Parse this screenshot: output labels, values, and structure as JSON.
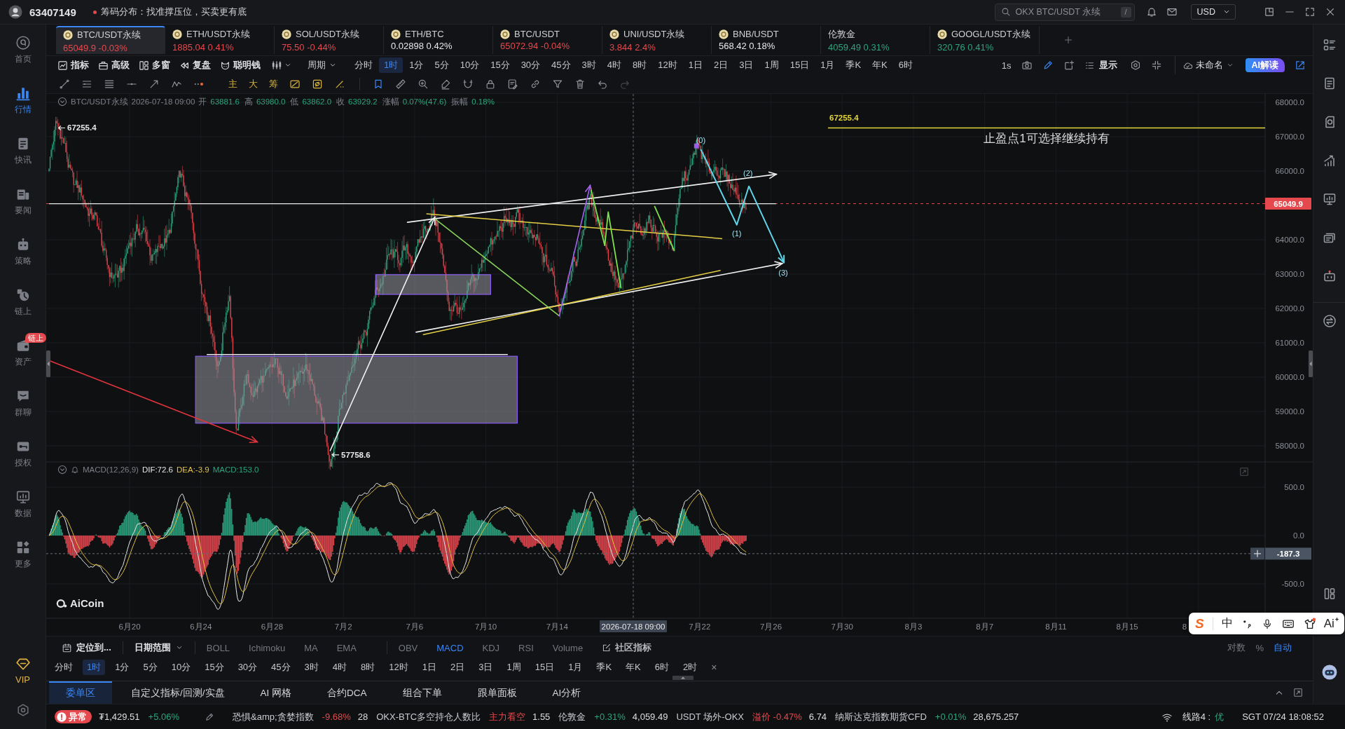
{
  "top_bar": {
    "user_id": "63407149",
    "notice": "筹码分布：找准撑压位，买卖更有底",
    "search": {
      "placeholder": "OKX BTC/USDT 永续",
      "shortcut": "/"
    },
    "currency": "USD"
  },
  "sidebar": {
    "items": [
      {
        "label": "首页",
        "selected": false
      },
      {
        "label": "行情",
        "selected": true
      },
      {
        "label": "快讯",
        "selected": false
      },
      {
        "label": "要闻",
        "selected": false
      },
      {
        "label": "策略",
        "selected": false
      },
      {
        "label": "链上",
        "selected": false
      },
      {
        "label": "资产",
        "selected": false,
        "badge": "链上"
      },
      {
        "label": "群聊",
        "selected": false
      },
      {
        "label": "授权",
        "selected": false
      },
      {
        "label": "数据",
        "selected": false
      },
      {
        "label": "更多",
        "selected": false
      }
    ],
    "vip": "VIP"
  },
  "tabs": [
    {
      "kind": "coin",
      "symbol": "BTC/USDT永续",
      "price": "65049.9",
      "change": "-0.03%",
      "color": "#e5484d",
      "selected": true
    },
    {
      "kind": "coin",
      "symbol": "ETH/USDT永续",
      "price": "1885.04",
      "change": "0.41%",
      "color": "#e5484d",
      "selected": false
    },
    {
      "kind": "coin",
      "symbol": "SOL/USDT永续",
      "price": "75.50",
      "change": "-0.44%",
      "color": "#e5484d",
      "selected": false
    },
    {
      "kind": "coin",
      "symbol": "ETH/BTC",
      "price": "0.02898",
      "change": "0.42%",
      "color": "#e8e8ea",
      "selected": false
    },
    {
      "kind": "coin",
      "symbol": "BTC/USDT",
      "price": "65072.94",
      "change": "-0.04%",
      "color": "#e5484d",
      "selected": false
    },
    {
      "kind": "coin",
      "symbol": "UNI/USDT永续",
      "price": "3.844",
      "change": "2.4%",
      "color": "#e5484d",
      "selected": false
    },
    {
      "kind": "coin",
      "symbol": "BNB/USDT",
      "price": "568.42",
      "change": "0.18%",
      "color": "#e8e8ea",
      "selected": false
    },
    {
      "kind": "plain",
      "symbol": "伦敦金",
      "price": "4059.49",
      "change": "0.31%",
      "color": "#2ea37c",
      "selected": false
    },
    {
      "kind": "coin",
      "symbol": "GOOGL/USDT永续",
      "price": "320.76",
      "change": "0.41%",
      "color": "#2ea37c",
      "selected": false
    }
  ],
  "toolbar": {
    "tools": [
      "指标",
      "高级",
      "多窗",
      "复盘",
      "聪明钱"
    ],
    "period_menu": "周期",
    "periods": [
      {
        "label": "分时",
        "selected": false
      },
      {
        "label": "1时",
        "selected": true
      },
      {
        "label": "1分",
        "selected": false
      },
      {
        "label": "5分",
        "selected": false
      },
      {
        "label": "10分",
        "selected": false
      },
      {
        "label": "15分",
        "selected": false
      },
      {
        "label": "30分",
        "selected": false
      },
      {
        "label": "45分",
        "selected": false
      },
      {
        "label": "3时",
        "selected": false
      },
      {
        "label": "4时",
        "selected": false
      },
      {
        "label": "8时",
        "selected": false
      },
      {
        "label": "12时",
        "selected": false
      },
      {
        "label": "1日",
        "selected": false
      },
      {
        "label": "2日",
        "selected": false
      },
      {
        "label": "3日",
        "selected": false
      },
      {
        "label": "1周",
        "selected": false
      },
      {
        "label": "15日",
        "selected": false
      },
      {
        "label": "1月",
        "selected": false
      },
      {
        "label": "季K",
        "selected": false
      },
      {
        "label": "年K",
        "selected": false
      },
      {
        "label": "6时",
        "selected": false
      }
    ],
    "interval": "1s",
    "draw_mode": true,
    "display": "显示",
    "layout_name": "未命名",
    "ai_button": "AI解读"
  },
  "drawing_bar": {
    "marks": [
      "主",
      "大",
      "筹"
    ],
    "keep_drawing": true,
    "redo_disabled": true
  },
  "chart": {
    "legend": {
      "symbol": "BTC/USDT永续",
      "time": "2026-07-18 09:00",
      "fields": [
        {
          "label": "开",
          "value": "63881.6"
        },
        {
          "label": "高",
          "value": "63980.0"
        },
        {
          "label": "低",
          "value": "63862.0"
        },
        {
          "label": "收",
          "value": "63929.2"
        },
        {
          "label": "涨幅",
          "value": "0.07%(47.6)"
        },
        {
          "label": "振幅",
          "value": "0.18%"
        }
      ]
    },
    "price_axis": [
      "68000.0",
      "67000.0",
      "66000.0",
      "64000.0",
      "63000.0",
      "62000.0",
      "61000.0",
      "60000.0",
      "59000.0",
      "58000.0"
    ],
    "price_tag": "65049.9",
    "high_mark": "67255.4",
    "low_mark": "57758.6",
    "target_label": "67255.4",
    "note": "止盈点1可选择继续持有",
    "wave_labels": [
      "(0)",
      "(1)",
      "(2)",
      "(3)"
    ],
    "date_axis": [
      "6月20",
      "6月24",
      "6月28",
      "7月2",
      "7月6",
      "7月10",
      "7月14",
      "7月22",
      "7月26",
      "7月30",
      "8月3",
      "8月7",
      "8月11",
      "8月15",
      "8"
    ],
    "crosshair_time": "2026-07-18 09:00",
    "logo": "AiCoin"
  },
  "macd": {
    "name": "MACD(12,26,9)",
    "dif": "DIF:72.6",
    "dea": "DEA:-3.9",
    "macd": "MACD:153.0",
    "axis": [
      "500.0",
      "0.0",
      "-500.0"
    ],
    "cursor_value": "-187.3"
  },
  "indicator_bar": {
    "locate": "定位到...",
    "date_range": "日期范围",
    "overlays": [
      {
        "label": "BOLL",
        "selected": false
      },
      {
        "label": "Ichimoku",
        "selected": false
      },
      {
        "label": "MA",
        "selected": false
      },
      {
        "label": "EMA",
        "selected": false
      }
    ],
    "panes": [
      {
        "label": "OBV",
        "selected": false
      },
      {
        "label": "MACD",
        "selected": true
      },
      {
        "label": "KDJ",
        "selected": false
      },
      {
        "label": "RSI",
        "selected": false
      },
      {
        "label": "Volume",
        "selected": false
      }
    ],
    "community": "社区指标",
    "scale_modes": [
      {
        "label": "对数",
        "selected": false
      },
      {
        "label": "%",
        "selected": false
      },
      {
        "label": "自动",
        "selected": true
      }
    ]
  },
  "period_bar": {
    "periods": [
      {
        "label": "分时",
        "selected": false
      },
      {
        "label": "1时",
        "selected": true
      },
      {
        "label": "1分",
        "selected": false
      },
      {
        "label": "5分",
        "selected": false
      },
      {
        "label": "10分",
        "selected": false
      },
      {
        "label": "15分",
        "selected": false
      },
      {
        "label": "30分",
        "selected": false
      },
      {
        "label": "45分",
        "selected": false
      },
      {
        "label": "3时",
        "selected": false
      },
      {
        "label": "4时",
        "selected": false
      },
      {
        "label": "8时",
        "selected": false
      },
      {
        "label": "12时",
        "selected": false
      },
      {
        "label": "1日",
        "selected": false
      },
      {
        "label": "2日",
        "selected": false
      },
      {
        "label": "3日",
        "selected": false
      },
      {
        "label": "1周",
        "selected": false
      },
      {
        "label": "15日",
        "selected": false
      },
      {
        "label": "1月",
        "selected": false
      },
      {
        "label": "季K",
        "selected": false
      },
      {
        "label": "年K",
        "selected": false
      },
      {
        "label": "6时",
        "selected": false
      },
      {
        "label": "2时",
        "selected": false
      }
    ],
    "close": "×"
  },
  "bottom_tabs": [
    {
      "label": "委单区",
      "selected": true
    },
    {
      "label": "自定义指标/回测/实盘",
      "selected": false
    },
    {
      "label": "AI 网格",
      "selected": false
    },
    {
      "label": "合约DCA",
      "selected": false
    },
    {
      "label": "组合下单",
      "selected": false
    },
    {
      "label": "跟单面板",
      "selected": false
    },
    {
      "label": "AI分析",
      "selected": false
    }
  ],
  "status_bar": {
    "alert": {
      "badge": "异常",
      "value": "₮1,429.51",
      "change": "+5.06%",
      "color": "#2ea37c"
    },
    "tickers": [
      {
        "label": "恐惧&amp;贪婪指数",
        "change": "-9.68%",
        "value": "28",
        "color": "#e5484d"
      },
      {
        "label": "OKX-BTC多空持仓人数比",
        "change": "主力看空",
        "value": "1.55",
        "color": "#e5484d"
      },
      {
        "label": "伦敦金",
        "change": "+0.31%",
        "value": "4,059.49",
        "color": "#2ea37c"
      },
      {
        "label": "USDT 场外-OKX",
        "change": "溢价 -0.47%",
        "value": "6.74",
        "color": "#e5484d"
      },
      {
        "label": "纳斯达克指数期货CFD",
        "change": "+0.01%",
        "value": "28,675.257",
        "color": "#2ea37c"
      }
    ],
    "line": "线路4 :",
    "line_quality": "优",
    "clock": "SGT 07/24 18:08:52"
  },
  "ime_bar": {
    "logo": "S",
    "mode": "中",
    "ai": "Ai"
  }
}
